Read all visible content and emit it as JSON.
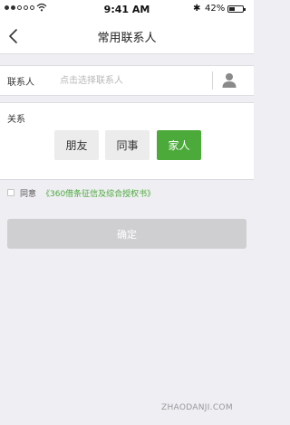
{
  "status_bar": {
    "time": "9:41 AM",
    "battery": "42%",
    "battery_level": 0.42,
    "bluetooth_glyph": "✱"
  },
  "nav": {
    "back_icon": "chevron-left-icon",
    "title": "常用联系人"
  },
  "contact": {
    "label": "联系人",
    "placeholder": "点击选择联系人",
    "value": "",
    "picker_icon": "person-icon"
  },
  "relation": {
    "label": "关系",
    "options": [
      "朋友",
      "同事",
      "家人"
    ],
    "selected": "家人",
    "accent_color": "#4caa3a"
  },
  "agreement": {
    "checked": false,
    "prefix": "同意",
    "link_text": "《360借条征信及综合授权书》"
  },
  "confirm": {
    "label": "确定",
    "enabled": false
  },
  "watermark": "ZHAODANJI.COM"
}
